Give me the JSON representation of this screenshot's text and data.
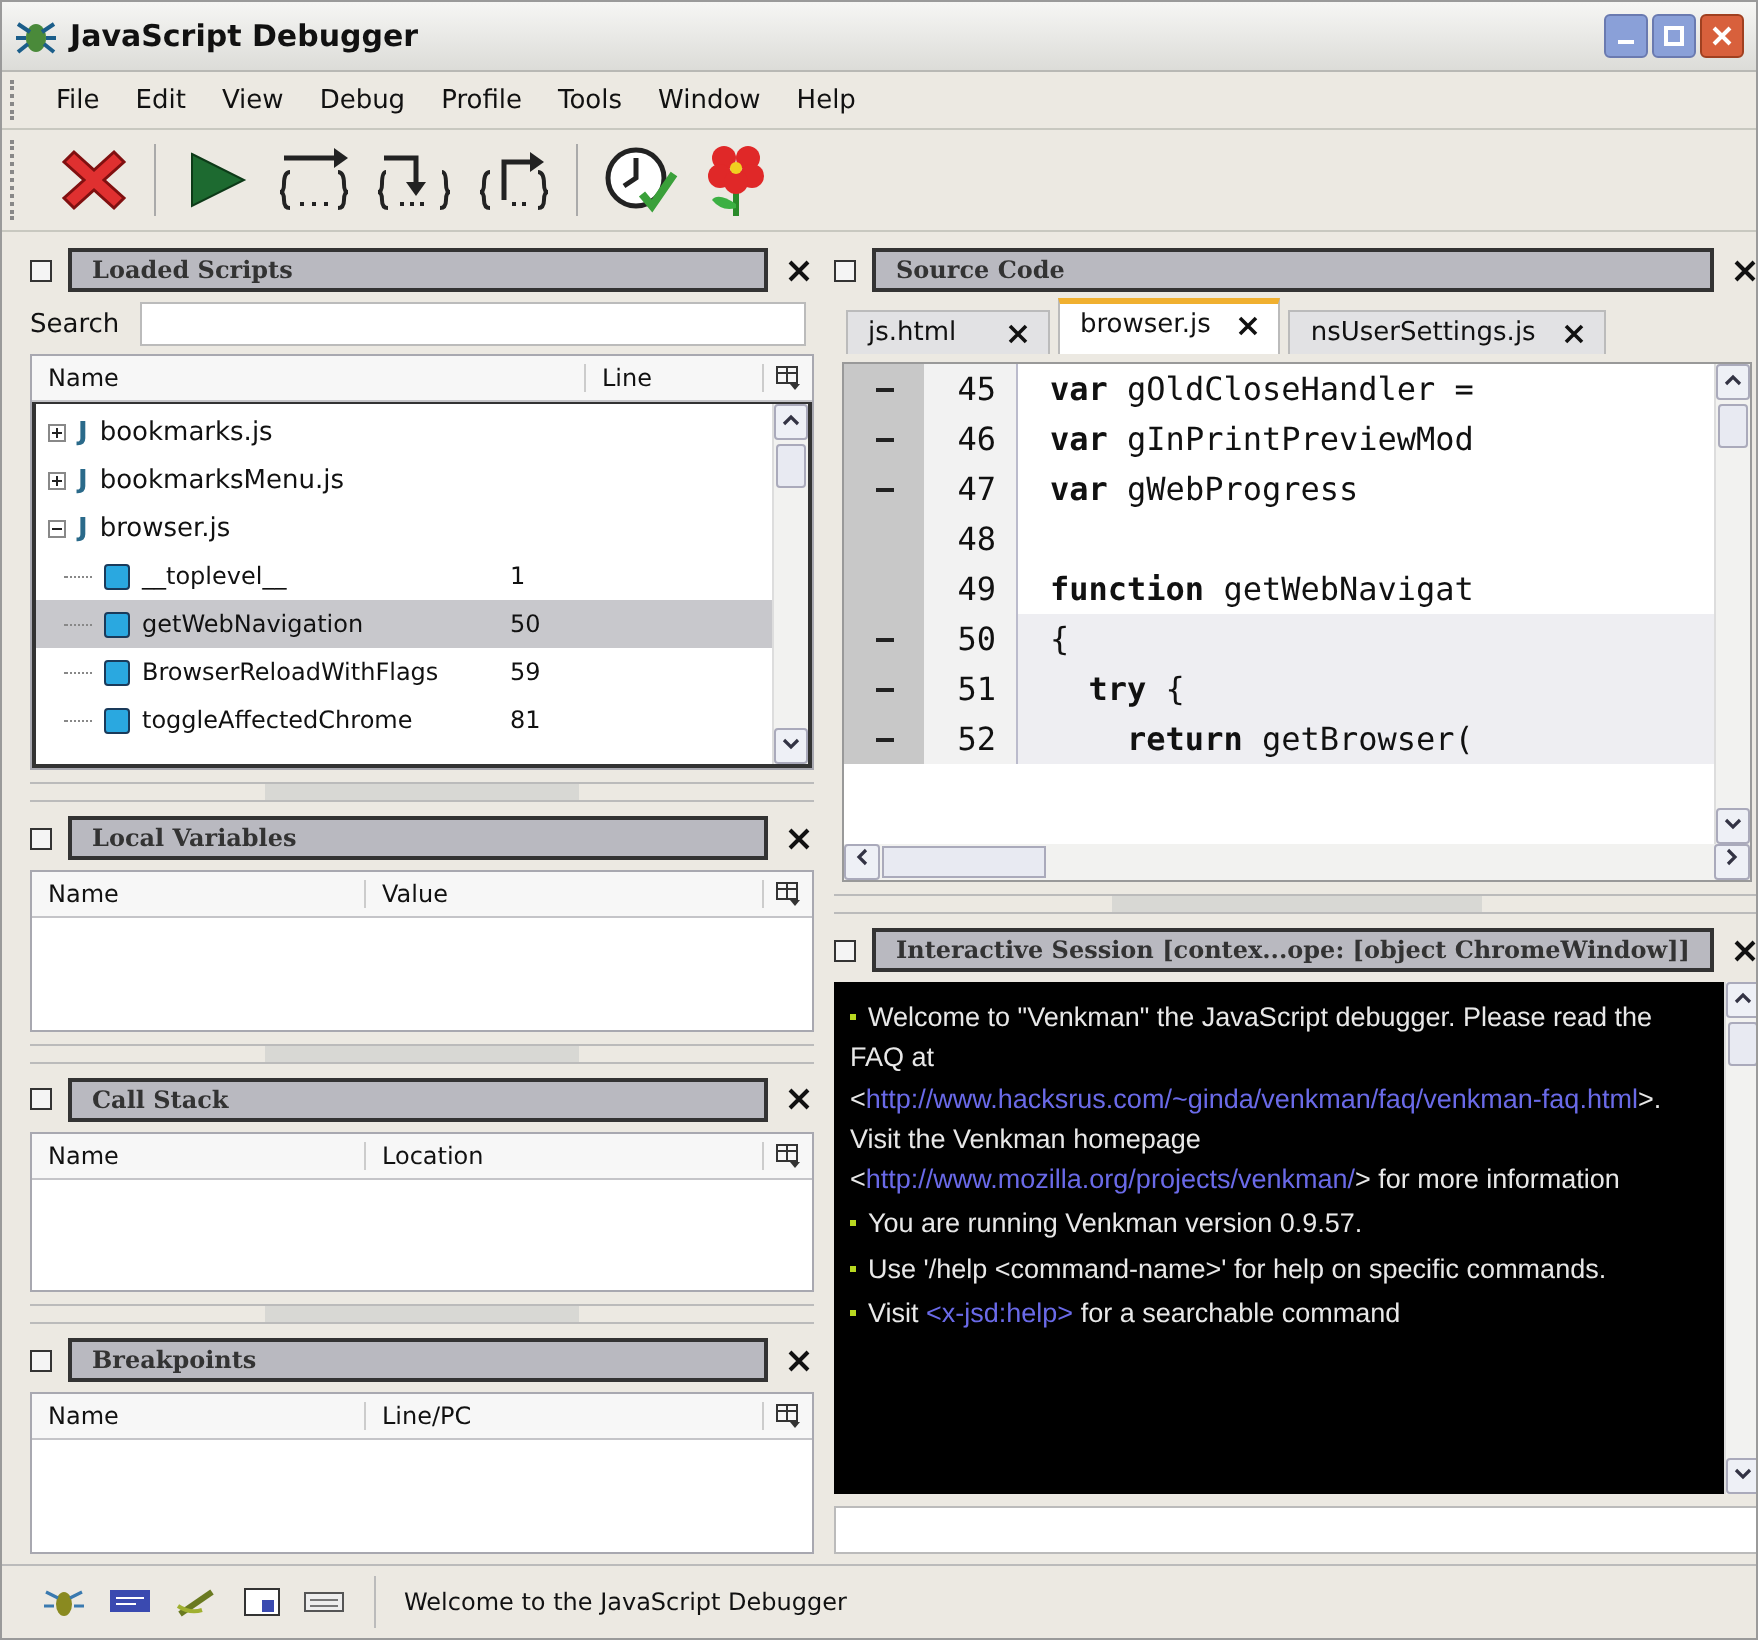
{
  "window": {
    "title": "JavaScript Debugger"
  },
  "menu": [
    "File",
    "Edit",
    "View",
    "Debug",
    "Profile",
    "Tools",
    "Window",
    "Help"
  ],
  "toolbar": [
    {
      "kind": "stop"
    },
    {
      "kind": "continue"
    },
    {
      "kind": "step-over"
    },
    {
      "kind": "step-into"
    },
    {
      "kind": "step-out"
    },
    {
      "kind": "profile"
    },
    {
      "kind": "pretty-print"
    }
  ],
  "loaded_scripts": {
    "title": "Loaded Scripts",
    "search_label": "Search",
    "columns": [
      "Name",
      "Line"
    ],
    "items": [
      {
        "icon": "J",
        "name": "bookmarks.js",
        "expanded": false
      },
      {
        "icon": "J",
        "name": "bookmarksMenu.js",
        "expanded": false
      },
      {
        "icon": "J",
        "name": "browser.js",
        "expanded": true,
        "children": [
          {
            "name": "__toplevel__",
            "line": "1",
            "selected": false
          },
          {
            "name": "getWebNavigation",
            "line": "50",
            "selected": true
          },
          {
            "name": "BrowserReloadWithFlags",
            "line": "59",
            "selected": false
          },
          {
            "name": "toggleAffectedChrome",
            "line": "81",
            "selected": false
          }
        ]
      }
    ]
  },
  "local_variables": {
    "title": "Local Variables",
    "columns": [
      "Name",
      "Value"
    ]
  },
  "call_stack": {
    "title": "Call Stack",
    "columns": [
      "Name",
      "Location"
    ]
  },
  "breakpoints": {
    "title": "Breakpoints",
    "columns": [
      "Name",
      "Line/PC"
    ]
  },
  "source_code": {
    "title": "Source Code",
    "tabs": [
      {
        "label": "js.html",
        "selected": false
      },
      {
        "label": "browser.js",
        "selected": true
      },
      {
        "label": "nsUserSettings.js",
        "selected": false
      }
    ],
    "lines": [
      {
        "number": "45",
        "breakable": true,
        "current": false,
        "code": "**var** gOldCloseHandler ="
      },
      {
        "number": "46",
        "breakable": true,
        "current": false,
        "code": "**var** gInPrintPreviewMod"
      },
      {
        "number": "47",
        "breakable": true,
        "current": false,
        "code": "**var** gWebProgress"
      },
      {
        "number": "48",
        "breakable": false,
        "current": false
      },
      {
        "number": "49",
        "breakable": false,
        "current": false,
        "code": "**function** getWebNavigat"
      },
      {
        "number": "50",
        "breakable": true,
        "current": true,
        "code": "{"
      },
      {
        "number": "51",
        "breakable": true,
        "current": true,
        "code": "  **try** {"
      },
      {
        "number": "52",
        "breakable": true,
        "current": true,
        "code": "    **return** getBrowser("
      }
    ]
  },
  "interactive_session": {
    "title": "Interactive Session [contex...ope: [object ChromeWindow]]",
    "messages": [
      {
        "parts": [
          {
            "kind": "text",
            "text": "Welcome to \"Venkman\" the JavaScript debugger. Please read the FAQ at <"
          },
          {
            "kind": "link",
            "text": "http://www.hacksrus.com/~ginda/venkman/faq/venkman-faq.html"
          },
          {
            "kind": "text",
            "text": ">. Visit the Venkman homepage <"
          },
          {
            "kind": "link",
            "text": "http://www.mozilla.org/projects/venkman/"
          },
          {
            "kind": "text",
            "text": "> for more information"
          }
        ]
      },
      {
        "parts": [
          {
            "kind": "text",
            "text": "You are running Venkman version 0.9.57."
          }
        ]
      },
      {
        "parts": [
          {
            "kind": "text",
            "text": "Use '/help <command-name>' for help on specific commands."
          }
        ]
      },
      {
        "parts": [
          {
            "kind": "text",
            "text": "Visit "
          },
          {
            "kind": "link",
            "text": "<x-jsd:help>"
          },
          {
            "kind": "text",
            "text": " for a searchable command"
          }
        ]
      }
    ]
  },
  "status_bar": {
    "icons": [
      {
        "kind": "bug"
      },
      {
        "kind": "console"
      },
      {
        "kind": "wand"
      },
      {
        "kind": "window"
      },
      {
        "kind": "keyboard"
      }
    ],
    "text": "Welcome to the JavaScript Debugger"
  }
}
